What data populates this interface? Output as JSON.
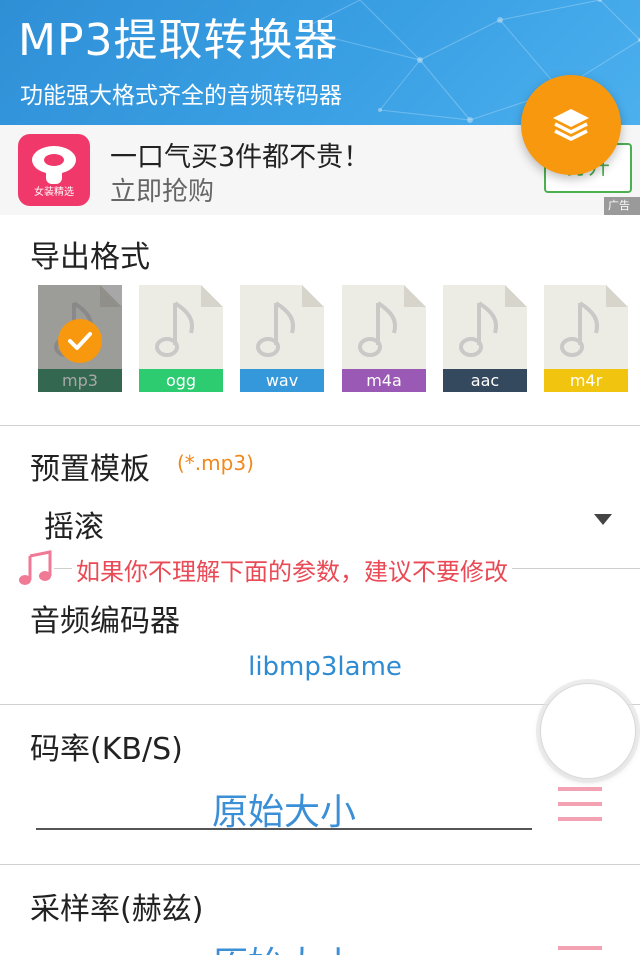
{
  "header": {
    "title": "MP3提取转换器",
    "subtitle": "功能强大格式齐全的音频转码器"
  },
  "ad": {
    "logo_text": "女装精选",
    "title": "一口气买3件都不贵！",
    "subtitle": "立即抢购",
    "button_label": "打开",
    "tag": "广告"
  },
  "export_format": {
    "label": "导出格式",
    "formats": [
      {
        "name": "mp3",
        "color": "#2e8b62",
        "selected": true
      },
      {
        "name": "ogg",
        "color": "#2ecc71",
        "selected": false
      },
      {
        "name": "wav",
        "color": "#3498db",
        "selected": false
      },
      {
        "name": "m4a",
        "color": "#9b59b6",
        "selected": false
      },
      {
        "name": "aac",
        "color": "#34495e",
        "selected": false
      },
      {
        "name": "m4r",
        "color": "#f1c40f",
        "selected": false
      }
    ]
  },
  "preset": {
    "label": "预置模板",
    "note": "(*.mp3)",
    "value": "摇滚"
  },
  "warning": {
    "text": "如果你不理解下面的参数，建议不要修改"
  },
  "codec": {
    "label": "音频编码器",
    "value": "libmp3lame"
  },
  "bitrate": {
    "label": "码率(KB/S)",
    "value": "原始大小"
  },
  "samplerate": {
    "label": "采样率(赫兹)",
    "value": "原始大小"
  },
  "colors": {
    "header_blue": "#3aa0e4",
    "accent_orange": "#f7980f",
    "value_blue": "#3b8fd6",
    "warning_red": "#e94a55",
    "menu_pink": "#f2a2b2"
  }
}
